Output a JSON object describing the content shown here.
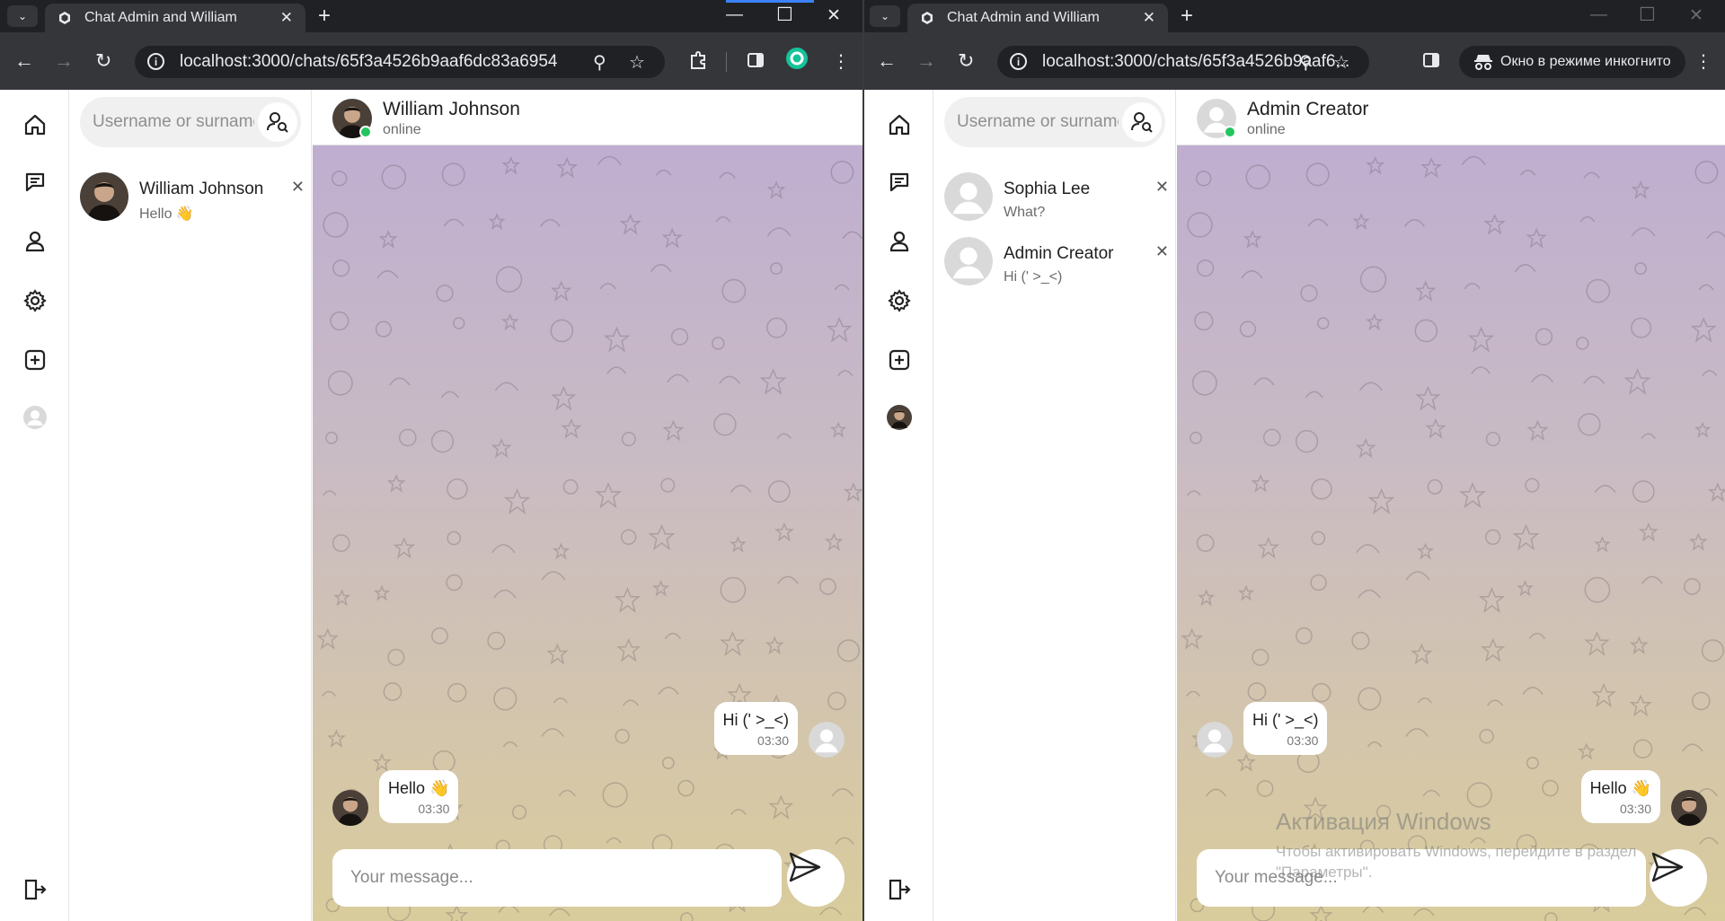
{
  "windowA": {
    "tab_title": "Chat Admin and William",
    "url": "localhost:3000/chats/65f3a4526b9aaf6dc83a6954",
    "search_placeholder": "Username or surname",
    "chats": [
      {
        "name": "William Johnson",
        "preview": "Hello 👋"
      }
    ],
    "header": {
      "name": "William Johnson",
      "status": "online"
    },
    "messages": [
      {
        "text": "Hi (' >_<)",
        "time": "03:30",
        "side": "right"
      },
      {
        "text": "Hello 👋",
        "time": "03:30",
        "side": "left"
      }
    ],
    "composer_placeholder": "Your message..."
  },
  "windowB": {
    "tab_title": "Chat Admin and William",
    "url": "localhost:3000/chats/65f3a4526b9aaf6...",
    "incognito_label": "Окно в режиме инкогнито",
    "search_placeholder": "Username or surname",
    "chats": [
      {
        "name": "Sophia Lee",
        "preview": "What?"
      },
      {
        "name": "Admin Creator",
        "preview": "Hi (' >_<)"
      }
    ],
    "header": {
      "name": "Admin Creator",
      "status": "online"
    },
    "messages": [
      {
        "text": "Hi (' >_<)",
        "time": "03:30",
        "side": "left"
      },
      {
        "text": "Hello 👋",
        "time": "03:30",
        "side": "right"
      }
    ],
    "composer_placeholder": "Your message..."
  },
  "watermark": {
    "title": "Активация Windows",
    "line1": "Чтобы активировать Windows, перейдите в раздел",
    "line2": "\"Параметры\"."
  },
  "colors": {
    "chrome_dark": "#202124",
    "chrome_toolbar": "#35363a",
    "online_green": "#22c55e"
  },
  "icons": [
    "home-icon",
    "messages-icon",
    "profile-icon",
    "settings-icon",
    "add-icon",
    "avatar",
    "logout-icon",
    "search-user-icon",
    "send-icon"
  ]
}
